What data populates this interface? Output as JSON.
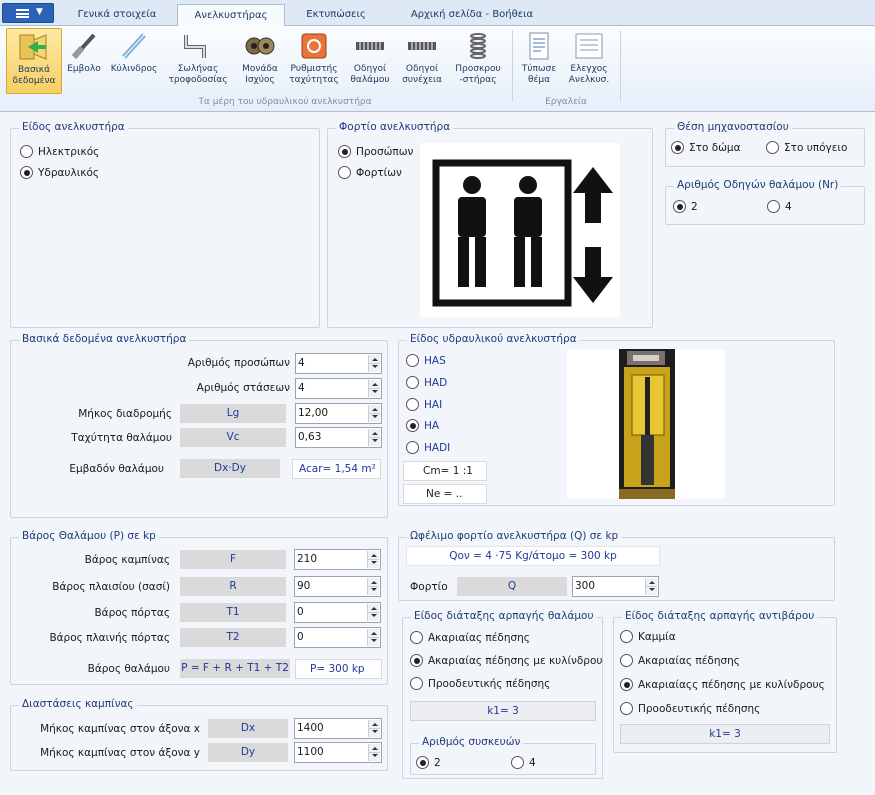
{
  "menu_tabs": [
    "Γενικά στοιχεία",
    "Ανελκυστήρας",
    "Εκτυπώσεις",
    "Αρχική σελίδα - Βοήθεια"
  ],
  "ribbon": {
    "buttons": [
      {
        "label": "Βασικά\nδεδομένα",
        "icon": "basic-data-icon"
      },
      {
        "label": "Εμβολο",
        "icon": "piston-icon"
      },
      {
        "label": "Κύλινδρος",
        "icon": "cylinder-icon"
      },
      {
        "label": "Σωλήνας\nτροφοδοσίας",
        "icon": "supply-pipe-icon"
      },
      {
        "label": "Μονάδα\nΙσχύος",
        "icon": "power-unit-icon"
      },
      {
        "label": "Ρυθμιστής\nταχύτητας",
        "icon": "speed-regulator-icon"
      },
      {
        "label": "Οδηγοί\nθαλάμου",
        "icon": "car-guides-icon"
      },
      {
        "label": "Οδηγοί\nσυνέχεια",
        "icon": "guides-cont-icon"
      },
      {
        "label": "Προσκρου\n-στήρας",
        "icon": "buffer-icon"
      },
      {
        "label": "Τύπωσε\nθέμα",
        "icon": "print-icon"
      },
      {
        "label": "Ελεγχος\nΑνελκυσ.",
        "icon": "check-icon"
      }
    ],
    "group_parts": "Τα μέρη του υδραυλικού ανελκυστήρα",
    "group_tools": "Εργαλεία"
  },
  "lift_type": {
    "title": "Είδος ανελκυστήρα",
    "options": [
      "Ηλεκτρικός",
      "Υδραυλικός"
    ],
    "selected": 1
  },
  "lift_load": {
    "title": "Φορτίο ανελκυστήρα",
    "options": [
      "Προσώπων",
      "Φορτίων"
    ],
    "selected": 0
  },
  "machine_room": {
    "title": "Θέση μηχανοστασίου",
    "options": [
      "Στο δώμα",
      "Στο υπόγειο"
    ],
    "selected": 0
  },
  "guides_count": {
    "title": "Αριθμός Οδηγών θαλάμου (Nr)",
    "options": [
      "2",
      "4"
    ],
    "selected": 0
  },
  "basic_data": {
    "title": "Βασικά δεδομένα ανελκυστήρα",
    "persons_label": "Αριθμός προσώπων",
    "persons": "4",
    "stops_label": "Αριθμός στάσεων",
    "stops": "4",
    "travel_label": "Μήκος διαδρομής",
    "travel_sym": "Lg",
    "travel": "12,00",
    "speed_label": "Ταχύτητα θαλάμου",
    "speed_sym": "Vc",
    "speed": "0,63",
    "area_label": "Εμβαδόν θαλάμου",
    "area_sym": "Dx·Dy",
    "area_result": "Acar= 1,54  m²"
  },
  "hydraulic_type": {
    "title": "Είδος υδραυλικού ανελκυστήρα",
    "options": [
      "HAS",
      "HAD",
      "HAI",
      "HA",
      "HADI"
    ],
    "selected": 3,
    "cm": "Cm= 1 :1",
    "ne": "Ne = .."
  },
  "car_weight": {
    "title": "Βάρος Θαλάμου (P) σε kp",
    "rows": [
      {
        "label": "Βάρος καμπίνας",
        "sym": "F",
        "value": "210"
      },
      {
        "label": "Βάρος πλαισίου (σασί)",
        "sym": "R",
        "value": "90"
      },
      {
        "label": "Βάρος πόρτας",
        "sym": "T1",
        "value": "0"
      },
      {
        "label": "Βάρος πλαινής πόρτας",
        "sym": "T2",
        "value": "0"
      }
    ],
    "total_label": "Βάρος θαλάμου",
    "total_formula": "P = F + R + T1 + T2",
    "total_result": "P= 300  kp"
  },
  "useful_load": {
    "title": "Ωφέλιμο φορτίο ανελκυστήρα (Q) σε kp",
    "formula": "Qον = 4 ·75 Kg/άτομο = 300 kp",
    "load_label": "Φορτίο",
    "load_sym": "Q",
    "load": "300"
  },
  "cabin_dims": {
    "title": "Διαστάσεις καμπίνας",
    "x_label": "Μήκος καμπίνας στον άξονα x",
    "x_sym": "Dx",
    "x": "1400",
    "y_label": "Μήκος καμπίνας στον άξονα y",
    "y_sym": "Dy",
    "y": "1100"
  },
  "car_safety": {
    "title": "Είδος διάταξης αρπαγής θαλάμου",
    "options": [
      "Ακαριαίας πέδησης",
      "Ακαριαίας πέδησης με κυλίνδρους",
      "Προοδευτικής πέδησης"
    ],
    "selected": 1,
    "k1": "k1= 3",
    "devices_title": "Αριθμός συσκευών",
    "devices": [
      "2",
      "4"
    ],
    "devices_selected": 0
  },
  "cw_safety": {
    "title": "Είδος διάταξης αρπαγής αντιβάρου",
    "options": [
      "Καμμία",
      "Ακαριαίας πέδησης",
      "Ακαριαίαςς πέδησης με κυλίνδρους",
      "Προοδευτικής πέδησης"
    ],
    "selected": 2,
    "k1": "k1= 3"
  }
}
